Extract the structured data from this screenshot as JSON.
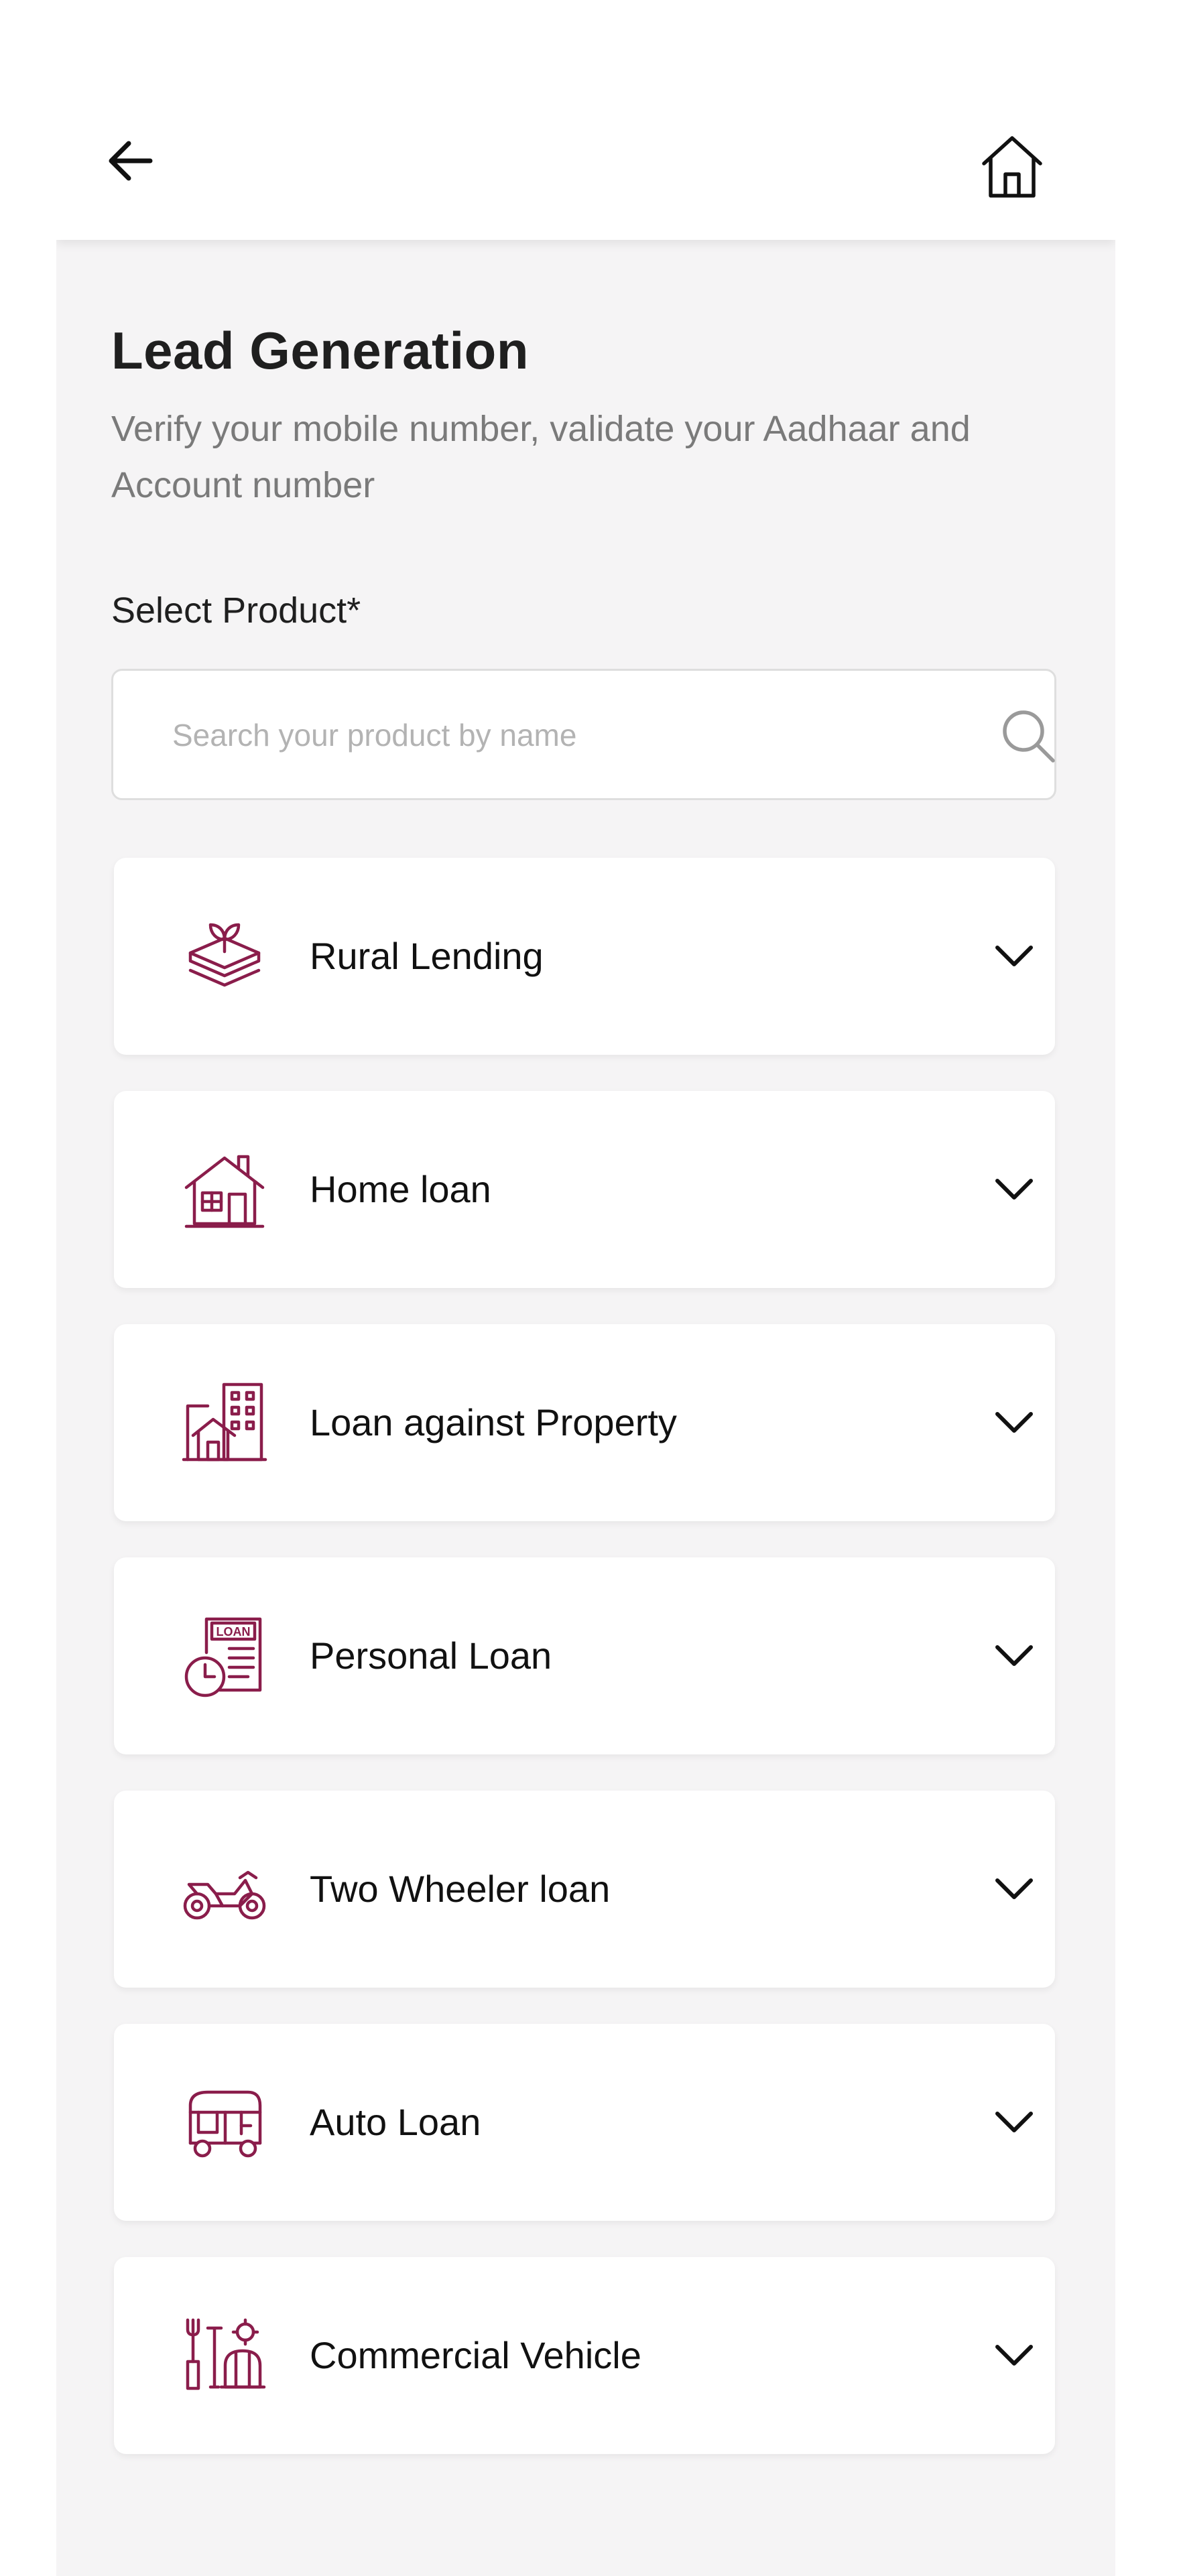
{
  "header": {
    "back_icon": "arrow-left-icon",
    "home_icon": "home-icon"
  },
  "page": {
    "title": "Lead Generation",
    "subtitle": "Verify your mobile number, validate your Aadhaar and Account number",
    "select_label": "Select Product*",
    "search_placeholder": "Search your product by name",
    "search_icon": "search-icon"
  },
  "colors": {
    "accent": "#8a1d4b",
    "background": "#f5f4f5",
    "title": "#1f1f1f",
    "subtitle": "#7a7a7a"
  },
  "products": [
    {
      "label": "Rural Lending",
      "icon": "rural-lending-icon"
    },
    {
      "label": "Home loan",
      "icon": "home-loan-icon"
    },
    {
      "label": "Loan against Property",
      "icon": "loan-against-property-icon"
    },
    {
      "label": "Personal Loan",
      "icon": "personal-loan-icon"
    },
    {
      "label": "Two Wheeler loan",
      "icon": "two-wheeler-icon"
    },
    {
      "label": "Auto Loan",
      "icon": "auto-rickshaw-icon"
    },
    {
      "label": "Commercial Vehicle",
      "icon": "commercial-vehicle-icon"
    }
  ],
  "personal_loan_icon_text": "LOAN"
}
